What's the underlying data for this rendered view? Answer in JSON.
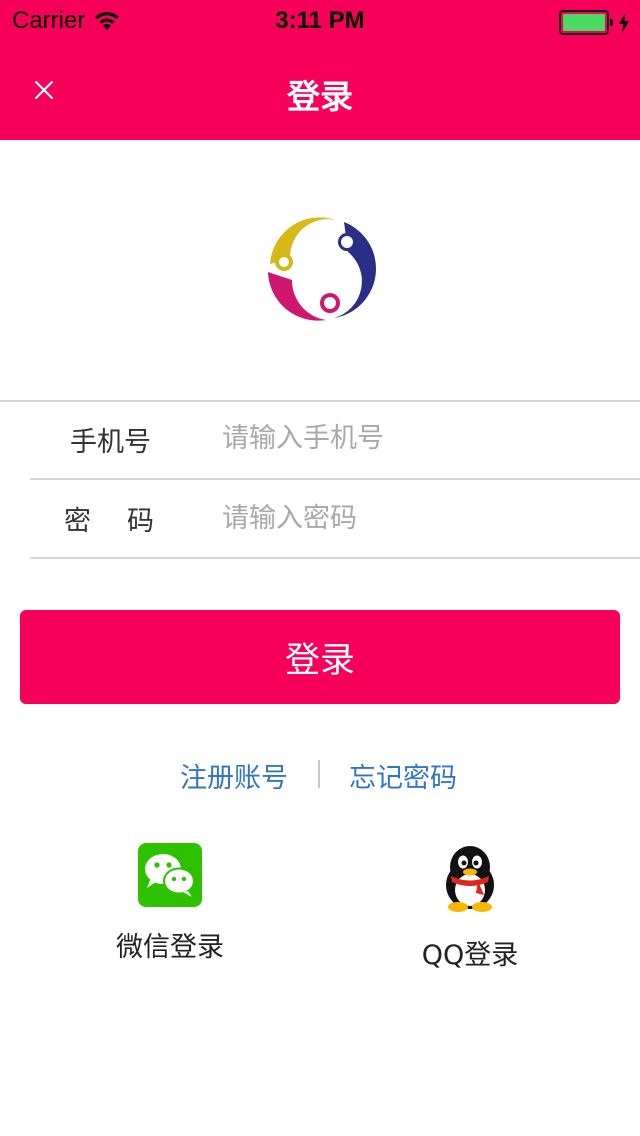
{
  "status_bar": {
    "carrier": "Carrier",
    "time": "3:11 PM",
    "battery_level": 1.0
  },
  "nav": {
    "title": "登录",
    "close_icon": "close-icon"
  },
  "form": {
    "phone_label": "手机号",
    "phone_placeholder": "请输入手机号",
    "phone_value": "",
    "password_label": "密码",
    "password_placeholder": "请输入密码",
    "password_value": ""
  },
  "login_button_label": "登录",
  "links": {
    "register": "注册账号",
    "forgot": "忘记密码"
  },
  "social": {
    "wechat_label": "微信登录",
    "qq_label": "QQ登录"
  },
  "colors": {
    "brand": "#f7005a",
    "link": "#3276c3",
    "wechat": "#2dc100"
  }
}
